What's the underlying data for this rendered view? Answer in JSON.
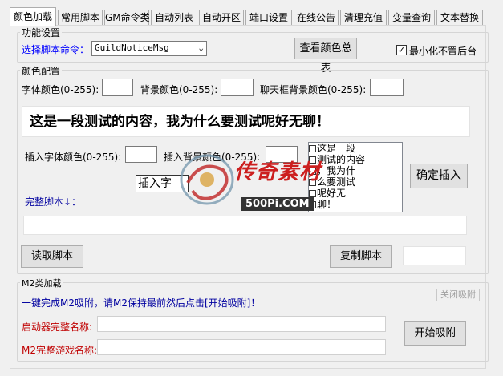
{
  "tabs": [
    {
      "label": "颜色加载",
      "active": true
    },
    {
      "label": "常用脚本"
    },
    {
      "label": "GM命令类"
    },
    {
      "label": "自动列表"
    },
    {
      "label": "自动开区"
    },
    {
      "label": "端口设置"
    },
    {
      "label": "在线公告"
    },
    {
      "label": "清理充值"
    },
    {
      "label": "变量查询"
    },
    {
      "label": "文本替换"
    }
  ],
  "func": {
    "legend": "功能设置",
    "select_label": "选择脚本命令：",
    "select_value": "GuildNoticeMsg",
    "view_colors_button": "查看颜色总表",
    "minimize_label": "最小化不置后台",
    "minimize_checked": true
  },
  "color": {
    "legend": "颜色配置",
    "font_color_label": "字体颜色(0-255):",
    "bg_color_label": "背景颜色(0-255):",
    "chat_bg_label": "聊天框背景颜色(0-255):",
    "preview_text": "这是一段测试的内容，我为什么要测试呢好无聊！",
    "insert_font_label": "插入字体颜色(0-255):",
    "insert_bg_label": "插入背景颜色(0-255):",
    "insert_button": "插入字",
    "confirm_insert_button": "确定插入",
    "full_script_label": "完整脚本↓：",
    "list_items": [
      "这是一段",
      "测试的内容",
      "，我为什",
      "么要测试",
      "呢好无",
      "聊！"
    ],
    "read_script_button": "读取脚本",
    "copy_script_button": "复制脚本"
  },
  "m2": {
    "legend": "M2类加载",
    "hint": "一键完成M2吸附，请M2保持最前然后点击[开始吸附]！",
    "close_attach_button": "关闭吸附",
    "launcher_label": "启动器完整名称:",
    "game_label": "M2完整游戏名称:",
    "start_attach_button": "开始吸附"
  },
  "watermark": {
    "brand": "传奇素材",
    "site": "500Pi.COM"
  },
  "colors": {
    "label_blue": "#0000ff",
    "label_red": "#c00000",
    "tab_border": "#adadad"
  }
}
